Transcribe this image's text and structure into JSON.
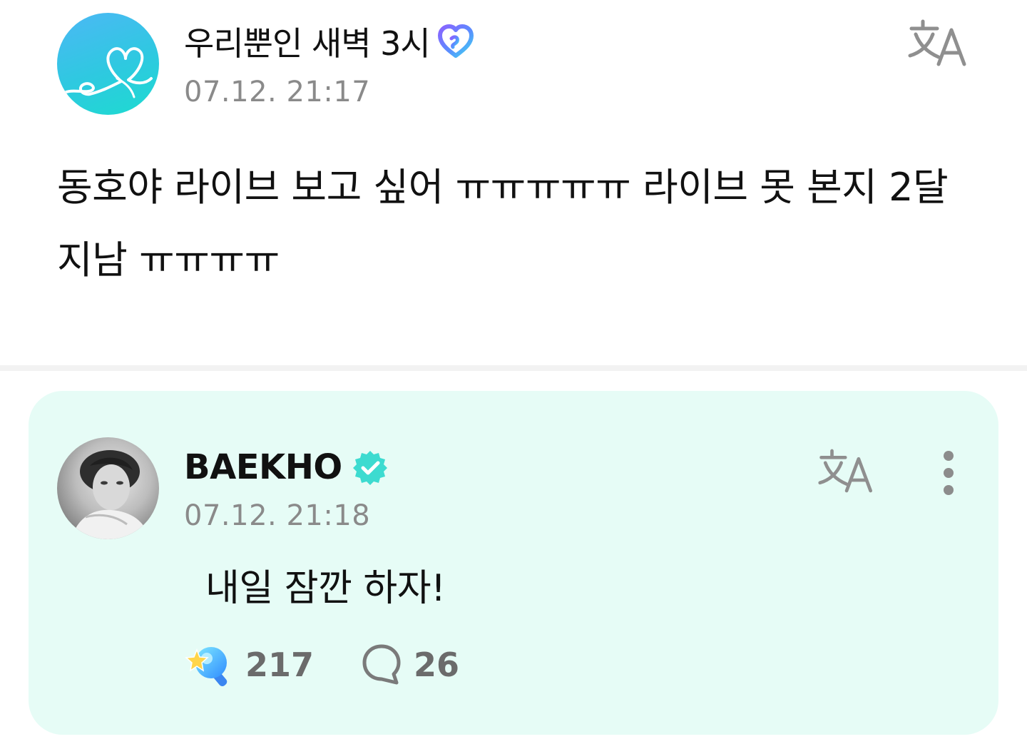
{
  "post": {
    "author": {
      "name": "우리뿐인 새벽 3시",
      "avatar_icon": "heart-swirl-logo",
      "avatar_colors": [
        "#4cb8f5",
        "#1ddbd0"
      ],
      "badge_icon": "membership-heart-icon"
    },
    "timestamp": "07.12. 21:17",
    "body": "동호야 라이브 보고 싶어 ㅠㅠㅠㅠㅠ 라이브 못 본지 2달 지남 ㅠㅠㅠㅠ",
    "translate_icon": "translate-icon"
  },
  "reply": {
    "author": {
      "name": "BAEKHO",
      "verified": true,
      "verified_color": "#3ddbd0"
    },
    "timestamp": "07.12. 21:18",
    "body": "내일 잠깐 하자!",
    "background_color": "#e6fcf6",
    "reactions": {
      "like_icon": "cheer-stick-icon",
      "like_count": "217",
      "comment_icon": "comment-bubble-icon",
      "comment_count": "26"
    }
  }
}
